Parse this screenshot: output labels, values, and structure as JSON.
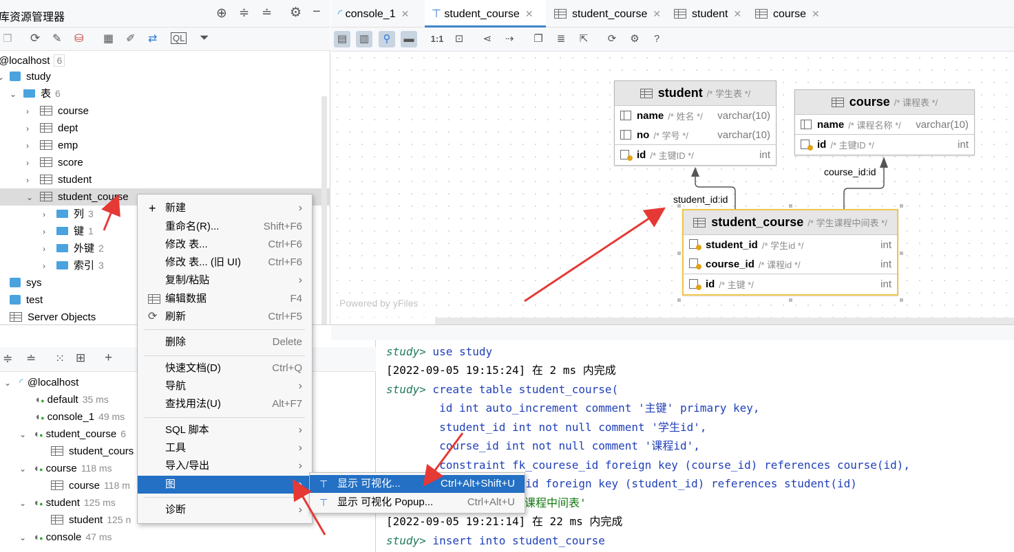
{
  "left_panel": {
    "title": "库资源管理器",
    "root": {
      "label": "@localhost",
      "count": "6"
    },
    "study": "study",
    "tables_folder": {
      "label": "表",
      "count": "6"
    },
    "tables": [
      "course",
      "dept",
      "emp",
      "score",
      "student",
      "student_course"
    ],
    "subfolders": [
      {
        "label": "列",
        "count": "3"
      },
      {
        "label": "键",
        "count": "1"
      },
      {
        "label": "外键",
        "count": "2"
      },
      {
        "label": "索引",
        "count": "3"
      }
    ],
    "other_schemas": [
      "sys",
      "test",
      "Server Objects"
    ]
  },
  "services_panel": {
    "root": "@localhost",
    "items": [
      {
        "label": "default",
        "time": "35 ms"
      },
      {
        "label": "console_1",
        "time": "49 ms"
      },
      {
        "label": "student_course",
        "time": "6"
      },
      {
        "label": "student_cours",
        "time": ""
      },
      {
        "label": "course",
        "time": "118 ms"
      },
      {
        "label": "course",
        "time": "118 m"
      },
      {
        "label": "student",
        "time": "125 ms"
      },
      {
        "label": "student",
        "time": "125 n"
      },
      {
        "label": "console",
        "time": "47 ms"
      }
    ]
  },
  "tabs": [
    "console_1",
    "student_course",
    "student_course",
    "student",
    "course"
  ],
  "diagram": {
    "watermark": "Powered by yFiles",
    "student": {
      "name": "student",
      "comment": "/* 学生表 */",
      "rows": [
        {
          "name": "name",
          "comment": "/* 姓名 */",
          "type": "varchar(10)"
        },
        {
          "name": "no",
          "comment": "/* 学号 */",
          "type": "varchar(10)"
        },
        {
          "name": "id",
          "comment": "/* 主键ID */",
          "type": "int"
        }
      ]
    },
    "course": {
      "name": "course",
      "comment": "/* 课程表 */",
      "rows": [
        {
          "name": "name",
          "comment": "/* 课程名称 */",
          "type": "varchar(10)"
        },
        {
          "name": "id",
          "comment": "/* 主键ID */",
          "type": "int"
        }
      ]
    },
    "student_course": {
      "name": "student_course",
      "comment": "/* 学生课程中间表 */",
      "rows": [
        {
          "name": "student_id",
          "comment": "/* 学生id */",
          "type": "int"
        },
        {
          "name": "course_id",
          "comment": "/* 课程id */",
          "type": "int"
        },
        {
          "name": "id",
          "comment": "/* 主键 */",
          "type": "int"
        }
      ]
    },
    "edge_labels": [
      "student_id:id",
      "course_id:id"
    ]
  },
  "context_menu": {
    "items": [
      {
        "label": "新建",
        "shortcut": "",
        "sub": true
      },
      {
        "label": "重命名(R)...",
        "shortcut": "Shift+F6"
      },
      {
        "label": "修改 表...",
        "shortcut": "Ctrl+F6"
      },
      {
        "label": "修改 表... (旧 UI)",
        "shortcut": "Ctrl+F6"
      },
      {
        "label": "复制/粘贴",
        "shortcut": "",
        "sub": true
      },
      {
        "label": "编辑数据",
        "shortcut": "F4"
      },
      {
        "label": "刷新",
        "shortcut": "Ctrl+F5"
      },
      {
        "label": "删除",
        "shortcut": "Delete"
      },
      {
        "label": "快速文档(D)",
        "shortcut": "Ctrl+Q"
      },
      {
        "label": "导航",
        "shortcut": "",
        "sub": true
      },
      {
        "label": "查找用法(U)",
        "shortcut": "Alt+F7"
      },
      {
        "label": "SQL 脚本",
        "shortcut": "",
        "sub": true
      },
      {
        "label": "工具",
        "shortcut": "",
        "sub": true
      },
      {
        "label": "导入/导出",
        "shortcut": "",
        "sub": true
      },
      {
        "label": "图",
        "shortcut": "",
        "sub": true
      },
      {
        "label": "诊断",
        "shortcut": "",
        "sub": true
      }
    ]
  },
  "submenu": {
    "items": [
      {
        "label": "显示 可视化...",
        "shortcut": "Ctrl+Alt+Shift+U"
      },
      {
        "label": "显示 可视化 Popup...",
        "shortcut": "Ctrl+Alt+U"
      }
    ]
  },
  "console": {
    "lines": [
      {
        "prompt": "study>",
        "code": " use study"
      },
      {
        "text": "[2022-09-05 19:15:24] 在 2 ms 内完成"
      },
      {
        "prompt": "study>",
        "code": " create table student_course("
      },
      {
        "code": "        id int auto_increment comment '主键' primary key,"
      },
      {
        "code": "        student_id int not null comment '学生id',"
      },
      {
        "code": "        course_id int not null comment '课程id',"
      },
      {
        "code": "        constraint fk_courese_id foreign key (course_id) references course(id),"
      },
      {
        "code": "        t fk_student_id foreign key (student_id) references student(id)"
      },
      {
        "code": "课程中间表'"
      },
      {
        "text": "[2022-09-05 19:21:14] 在 22 ms 内完成"
      },
      {
        "prompt": "study>",
        "code": " insert into student_course"
      }
    ]
  }
}
